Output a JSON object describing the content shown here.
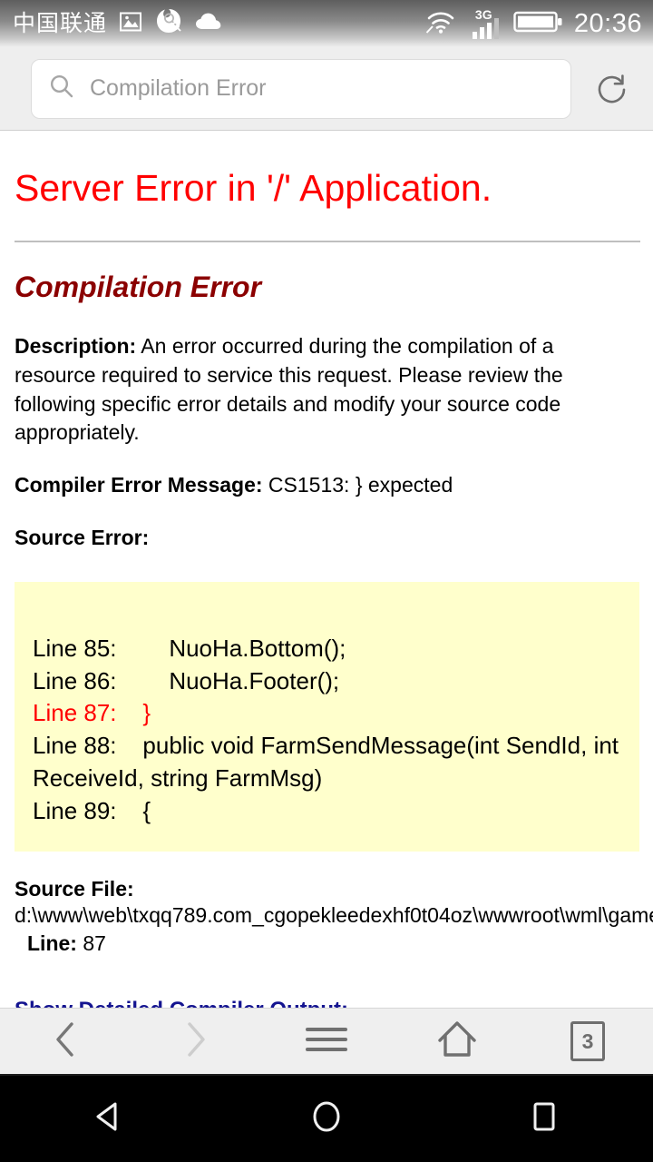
{
  "status_bar": {
    "carrier": "中国联通",
    "clock": "20:36",
    "network_label": "3G",
    "icons": [
      "gallery-icon",
      "search-assistant-icon",
      "cloud-icon",
      "wifi-icon",
      "signal-icon",
      "battery-icon"
    ]
  },
  "browser": {
    "search_value": "Compilation Error",
    "search_placeholder": "Compilation Error",
    "reload_icon": "reload-icon",
    "toolbar": {
      "back_label": "Back",
      "forward_label": "Forward",
      "menu_label": "Menu",
      "home_label": "Home",
      "tab_count": "3"
    }
  },
  "page": {
    "title": "Server Error in '/' Application.",
    "subtitle": "Compilation Error",
    "description_label": "Description:",
    "description_text": " An error occurred during the compilation of a resource required to service this request. Please review the following specific error details and modify your source code appropriately.",
    "compiler_error_label": "Compiler Error Message:",
    "compiler_error_text": " CS1513: } expected",
    "source_error_label": "Source Error:",
    "code_lines": [
      {
        "text": "Line 85:        NuoHa.Bottom();",
        "error": false
      },
      {
        "text": "Line 86:        NuoHa.Footer();",
        "error": false
      },
      {
        "text": "Line 87:    }",
        "error": true
      },
      {
        "text": "Line 88:    public void FarmSendMessage(int SendId, int ReceiveId, string FarmMsg)",
        "error": false
      },
      {
        "text": "Line 89:    {",
        "error": false
      }
    ],
    "source_file_label": "Source File:",
    "source_file_path": "d:\\www\\web\\txqq789.com_cgopekleedexhf0t04oz\\wwwroot\\wml\\game",
    "line_label": "Line:",
    "line_value": " 87",
    "detail_link": "Show Detailed Compiler Output:"
  },
  "android_nav": {
    "back": "back-triangle",
    "home": "home-circle",
    "recents": "recents-square"
  },
  "colors": {
    "error_red": "#ff0000",
    "subtitle_maroon": "#8b0000",
    "code_bg": "#ffffcc",
    "link_blue": "#141490"
  }
}
